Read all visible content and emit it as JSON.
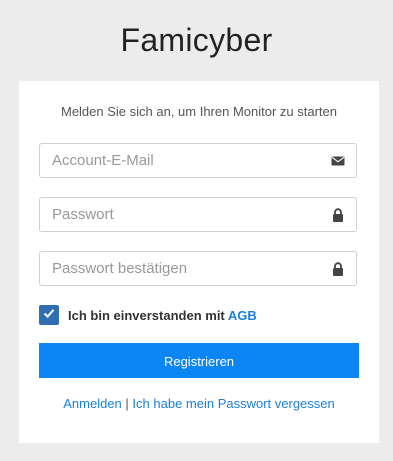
{
  "app": {
    "title": "Famicyber"
  },
  "form": {
    "intro": "Melden Sie sich an, um Ihren Monitor zu starten",
    "email_placeholder": "Account-E-Mail",
    "password_placeholder": "Passwort",
    "password_confirm_placeholder": "Passwort bestätigen",
    "terms_prefix": "Ich bin einverstanden mit",
    "terms_link": "AGB",
    "terms_checked": true,
    "submit_label": "Registrieren"
  },
  "footer_links": {
    "login": "Anmelden",
    "separator": "|",
    "forgot_password": "Ich habe mein Passwort vergessen"
  },
  "colors": {
    "background": "#ececec",
    "primary_button": "#0d86f5",
    "checkbox": "#2f6eb2",
    "link": "#1a7fd9"
  },
  "icons": {
    "email_field": "envelope-icon",
    "password_field": "lock-icon",
    "password_confirm_field": "lock-icon",
    "checkbox": "checkmark-icon"
  }
}
